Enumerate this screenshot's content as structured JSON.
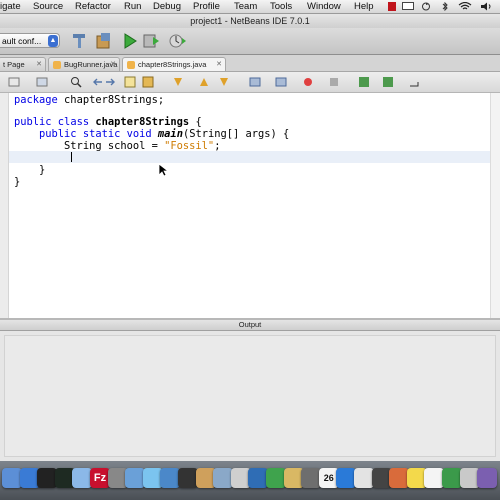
{
  "menubar": {
    "items": [
      "igate",
      "Source",
      "Refactor",
      "Run",
      "Debug",
      "Profile",
      "Team",
      "Tools",
      "Window",
      "Help"
    ]
  },
  "window": {
    "title": "project1 - NetBeans IDE 7.0.1"
  },
  "toolbar": {
    "config_value": "ault conf..."
  },
  "tabs": [
    {
      "label": "t Page",
      "active": false
    },
    {
      "label": "BugRunner.java",
      "active": false
    },
    {
      "label": "chapter8Strings.java",
      "active": true
    }
  ],
  "code": {
    "l1_kw": "package",
    "l1_rest": " chapter8Strings;",
    "l3_kw1": "public",
    "l3_kw2": " class ",
    "l3_name": "chapter8Strings",
    "l3_rest": " {",
    "l4_indent": "    ",
    "l4_kw1": "public",
    "l4_kw2": " static",
    "l4_kw3": " void ",
    "l4_method": "main",
    "l4_rest": "(String[] args) {",
    "l5_prefix": "        String school = ",
    "l5_string": "\"Fossil\"",
    "l5_suffix": ";",
    "l7": "    }",
    "l8": "}"
  },
  "output": {
    "title": "Output"
  },
  "dock": {
    "icons": [
      "finder-icon",
      "safari-icon",
      "dashboard-icon",
      "terminal-icon",
      "box-icon",
      "filezilla-icon",
      "gear-icon",
      "photos-icon",
      "chat-icon",
      "world-icon",
      "keyboard-icon",
      "music-icon",
      "mail-icon",
      "scanner-icon",
      "netbeans-icon",
      "sync-icon",
      "folder-icon",
      "preview-icon",
      "calendar-icon",
      "app-icon",
      "itunes-icon",
      "camera-icon",
      "paint-icon",
      "stickies-icon",
      "clock-icon",
      "flag-icon",
      "photo-booth-icon",
      "xcode-icon"
    ],
    "calendar_day": "26"
  }
}
